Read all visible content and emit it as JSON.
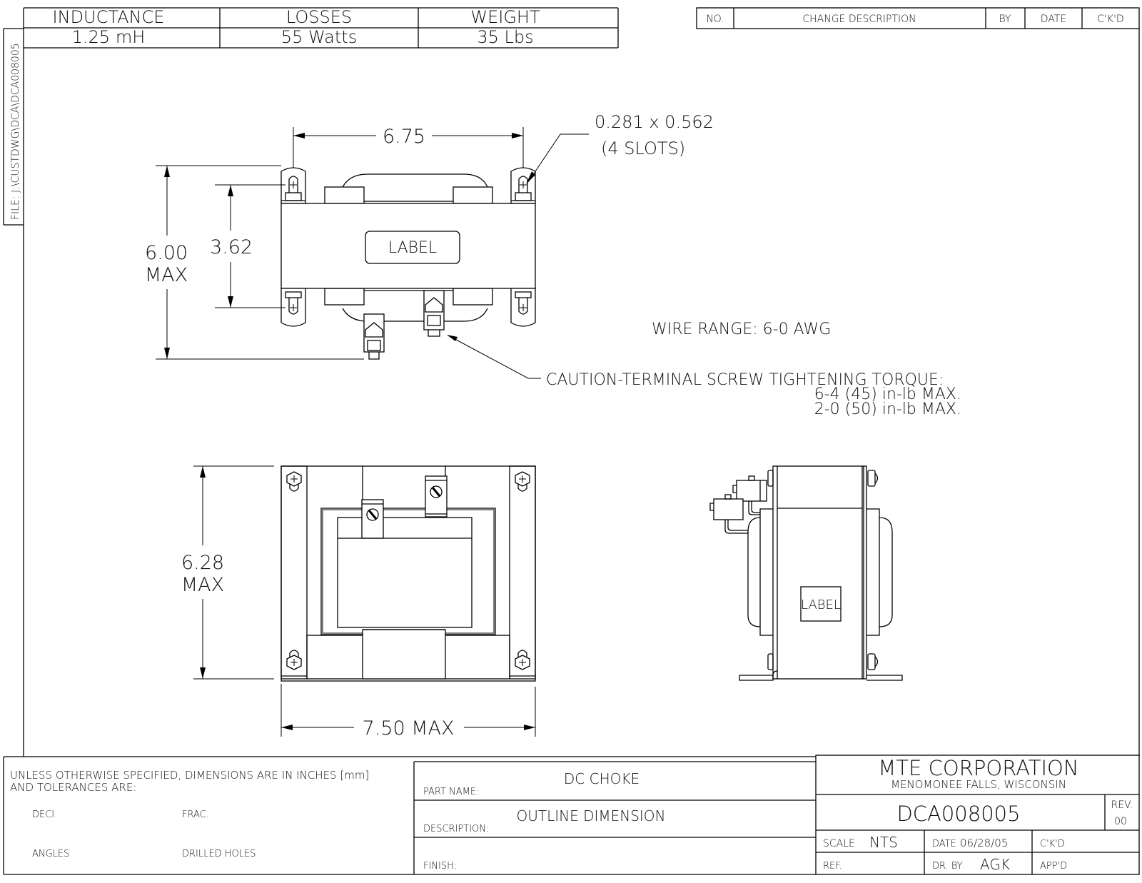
{
  "specs_table": {
    "headers": [
      "INDUCTANCE",
      "LOSSES",
      "WEIGHT"
    ],
    "values": [
      "1.25 mH",
      "55 Watts",
      "35 Lbs"
    ]
  },
  "revision_table": {
    "headers": [
      "NO.",
      "CHANGE DESCRIPTION",
      "BY",
      "DATE",
      "C'K'D"
    ],
    "rows": []
  },
  "file_path": "FILE: J:\\CUSTDWG\\DCA\\DCA008005",
  "top_view": {
    "width_dim": "6.75",
    "height_dim_value": "6.00",
    "height_dim_suffix": "MAX",
    "slot_spacing_dim": "3.62",
    "label_text": "LABEL",
    "slot_callout_line1": "0.281 x 0.562",
    "slot_callout_line2": "(4 SLOTS)"
  },
  "notes": {
    "wire_range": "WIRE RANGE: 6-0 AWG",
    "caution_line1": "CAUTION-TERMINAL SCREW TIGHTENING TORQUE:",
    "caution_line2": "6-4 (45) in-lb MAX.",
    "caution_line3": "2-0 (50) in-lb MAX."
  },
  "front_view": {
    "height_dim_value": "6.28",
    "height_dim_suffix": "MAX",
    "width_dim": "7.50 MAX"
  },
  "side_view": {
    "label_text": "LABEL"
  },
  "title_block": {
    "tolerance_note_line1": "UNLESS OTHERWISE SPECIFIED, DIMENSIONS ARE IN INCHES [mm]",
    "tolerance_note_line2": "AND TOLERANCES ARE:",
    "deci_label": "DECI.",
    "frac_label": "FRAC.",
    "angles_label": "ANGLES",
    "drilled_holes_label": "DRILLED HOLES",
    "part_name_label": "PART NAME:",
    "part_name": "DC CHOKE",
    "description_label": "DESCRIPTION:",
    "description": "OUTLINE DIMENSION",
    "finish_label": "FINISH:",
    "finish": "",
    "company": "MTE CORPORATION",
    "company_location": "MENOMONEE FALLS, WISCONSIN",
    "drawing_number": "DCA008005",
    "rev_label": "REV.",
    "rev": "00",
    "scale_label": "SCALE",
    "scale": "NTS",
    "date_label": "DATE",
    "date": "06/28/05",
    "ckd_label": "C'K'D",
    "ref_label": "REF.",
    "dr_by_label": "DR. BY",
    "dr_by": "AGK",
    "appd_label": "APP'D"
  }
}
